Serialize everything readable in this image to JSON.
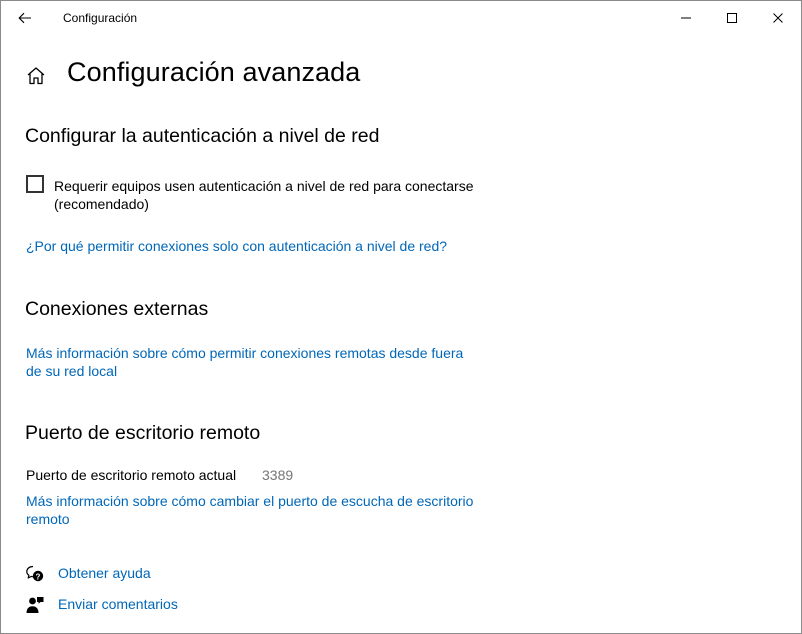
{
  "window": {
    "title": "Configuración"
  },
  "page": {
    "title": "Configuración avanzada"
  },
  "nla": {
    "heading": "Configurar la autenticación a nivel de red",
    "checkbox_label": "Requerir equipos usen autenticación a nivel de red para conectarse (recomendado)",
    "checkbox_checked": false,
    "link": "¿Por qué permitir conexiones solo con autenticación a nivel de red?"
  },
  "external": {
    "heading": "Conexiones externas",
    "link": "Más información sobre cómo permitir conexiones remotas desde fuera de su red local"
  },
  "port": {
    "heading": "Puerto de escritorio remoto",
    "label": "Puerto de escritorio remoto actual",
    "value": "3389",
    "link": "Más información sobre cómo cambiar el puerto de escucha de escritorio remoto"
  },
  "footer": {
    "help_label": "Obtener ayuda",
    "feedback_label": "Enviar comentarios"
  },
  "colors": {
    "link": "#0067b8",
    "secondary_text": "#767676"
  },
  "icons": {
    "back": "back-arrow-icon",
    "minimize": "minimize-icon",
    "maximize": "maximize-icon",
    "close": "close-icon",
    "home": "home-icon",
    "help": "help-chat-icon",
    "feedback": "feedback-person-icon"
  }
}
